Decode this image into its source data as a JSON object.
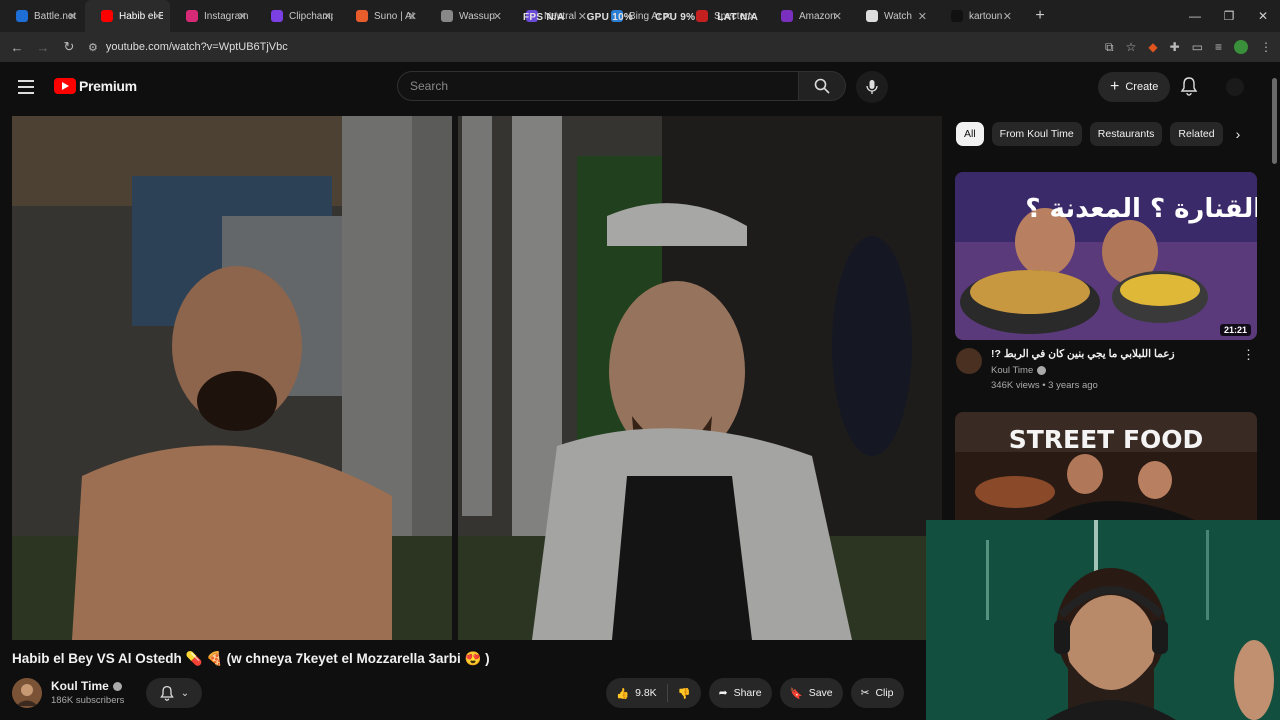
{
  "browser": {
    "tabs": [
      {
        "title": "Battle.net",
        "color": "#1d6fd6",
        "active": false
      },
      {
        "title": "Habib el Bey",
        "color": "#ff0000",
        "active": true
      },
      {
        "title": "Instagram",
        "color": "#d62976",
        "active": false
      },
      {
        "title": "Clipchamp",
        "color": "#7b3fe4",
        "active": false
      },
      {
        "title": "Suno | AI",
        "color": "#e85d2c",
        "active": false
      },
      {
        "title": "Wassup",
        "color": "#888888",
        "active": false
      },
      {
        "title": "Neutral",
        "color": "#6a4bd8",
        "active": false
      },
      {
        "title": "Bing Ar",
        "color": "#2a7fd4",
        "active": false
      },
      {
        "title": "Specter",
        "color": "#c42020",
        "active": false
      },
      {
        "title": "Amazon",
        "color": "#7b2fbf",
        "active": false
      },
      {
        "title": "Watch",
        "color": "#dddddd",
        "active": false
      },
      {
        "title": "kartoun",
        "color": "#111111",
        "active": false
      }
    ],
    "overlay_stats": {
      "fps": "FPS N/A",
      "gpu": "GPU 10%",
      "cpu": "CPU 9%",
      "lat": "LAT N/A"
    },
    "url": "youtube.com/watch?v=WptUB6TjVbc"
  },
  "header": {
    "logo_text": "Premium",
    "search_placeholder": "Search",
    "create_label": "Create"
  },
  "video": {
    "title": "Habib el Bey VS Al Ostedh 💊 🍕 (w chneya 7keyet el Mozzarella 3arbi 😍 )",
    "channel": "Koul Time",
    "subscribers": "186K subscribers",
    "likes": "9.8K",
    "share_label": "Share",
    "save_label": "Save",
    "clip_label": "Clip"
  },
  "chips": [
    "All",
    "From Koul Time",
    "Restaurants",
    "Related"
  ],
  "recommendations": [
    {
      "title": "زعما اللبلابي ما يجي بنين كان في الربط ?!",
      "channel": "Koul Time",
      "meta": "346K views • 3 years ago",
      "duration": "21:21",
      "thumb_text": "الربط ! القنارة ؟ المعدنة ؟"
    },
    {
      "title": "",
      "channel": "",
      "meta": "",
      "duration": "",
      "thumb_text": "STREET FOOD"
    }
  ]
}
